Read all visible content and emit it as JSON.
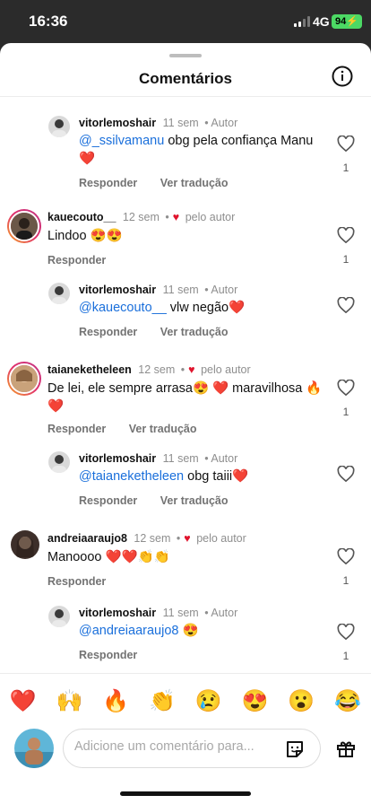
{
  "status_bar": {
    "time": "16:36",
    "network": "4G",
    "battery": "94"
  },
  "sheet": {
    "title": "Comentários",
    "info_icon": "info-icon"
  },
  "comments": [
    {
      "user": "vitorlemoshair",
      "time": "11 sem",
      "author_badge": "Autor",
      "mention": "@_ssilvamanu",
      "text": " obg pela confiança Manu ❤️",
      "actions": [
        "Responder",
        "Ver tradução"
      ],
      "likes": "1"
    },
    {
      "user": "kauecouto__",
      "time": "12 sem",
      "liked_by_author": "pelo autor",
      "text": "Lindoo 😍😍",
      "actions": [
        "Responder"
      ],
      "likes": "1"
    },
    {
      "user": "vitorlemoshair",
      "time": "11 sem",
      "author_badge": "Autor",
      "mention": "@kauecouto__",
      "text": "  vlw negão❤️",
      "actions": [
        "Responder",
        "Ver tradução"
      ],
      "likes": ""
    },
    {
      "user": "taianeketheleen",
      "time": "12 sem",
      "liked_by_author": "pelo autor",
      "text": "De lei, ele sempre arrasa😍 ❤️  maravilhosa 🔥 ❤️",
      "actions": [
        "Responder",
        "Ver tradução"
      ],
      "likes": "1"
    },
    {
      "user": "vitorlemoshair",
      "time": "11 sem",
      "author_badge": "Autor",
      "mention": "@taianeketheleen",
      "text": " obg taiii❤️",
      "actions": [
        "Responder",
        "Ver tradução"
      ],
      "likes": ""
    },
    {
      "user": "andreiaaraujo8",
      "time": "12 sem",
      "liked_by_author": "pelo autor",
      "text": "Manoooo ❤️❤️👏👏",
      "actions": [
        "Responder"
      ],
      "likes": "1"
    },
    {
      "user": "vitorlemoshair",
      "time": "11 sem",
      "author_badge": "Autor",
      "mention": "@andreiaaraujo8",
      "text": " 😍",
      "actions": [
        "Responder"
      ],
      "likes": "1"
    }
  ],
  "reactions": [
    "❤️",
    "🙌",
    "🔥",
    "👏",
    "😢",
    "😍",
    "😮",
    "😂"
  ],
  "composer": {
    "placeholder": "Adicione um comentário para...",
    "sticker_icon": "sticker-icon",
    "gift_icon": "gift-icon"
  },
  "colors": {
    "mention": "#1a6fdb",
    "heart": "#e0142d",
    "sheet_bg": "#ffffff",
    "backdrop": "#2b2b2b",
    "battery": "#4cd964"
  }
}
